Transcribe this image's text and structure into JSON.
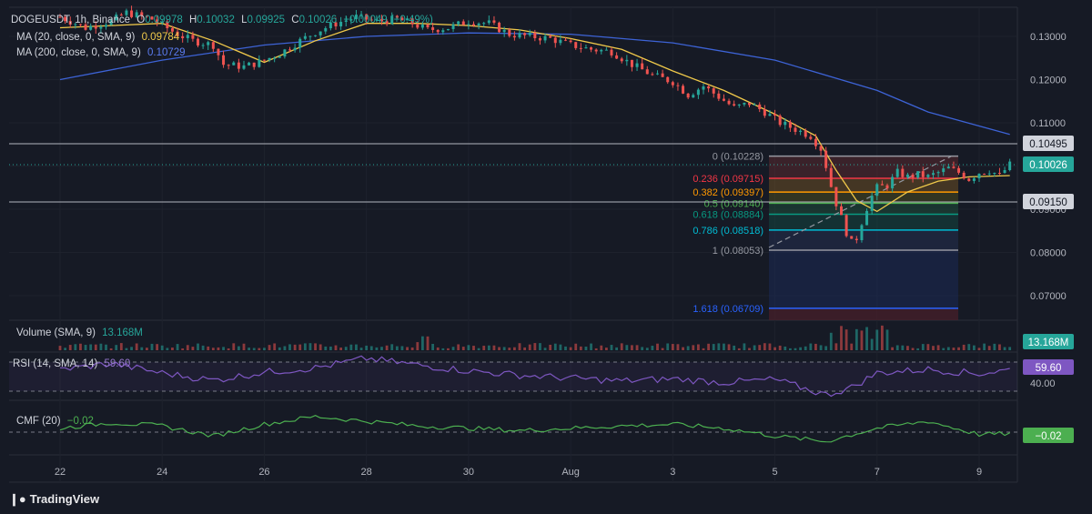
{
  "header": {
    "symbol_line": "DOGEUSDT, 1h, Binance",
    "o_label": "O",
    "o": "0.09978",
    "h_label": "H",
    "h": "0.10032",
    "l_label": "L",
    "l": "0.09925",
    "c_label": "C",
    "c": "0.10026",
    "change": "+0.00049 (+0.49%)",
    "ma20_label": "MA (20, close, 0, SMA, 9)",
    "ma20_value": "0.09784",
    "ma200_label": "MA (200, close, 0, SMA, 9)",
    "ma200_value": "0.10729"
  },
  "panes": {
    "volume_label": "Volume (SMA, 9)",
    "volume_value": "13.168M",
    "rsi_label": "RSI (14, SMA, 14)",
    "rsi_value": "59.60",
    "rsi_level": "40.00",
    "cmf_label": "CMF (20)",
    "cmf_value": "−0.02"
  },
  "price_axis_labels": [
    "0.13000",
    "0.12000",
    "0.11000",
    "0.10000",
    "0.09000",
    "0.08000",
    "0.07000"
  ],
  "price_tags": {
    "resistance": "0.10495",
    "current": "0.10026",
    "support": "0.09150",
    "volume": "13.168M",
    "rsi": "59.60",
    "cmf": "−0.02"
  },
  "colors": {
    "bg": "#161a25",
    "up": "#26a69a",
    "down": "#ef5350",
    "ma20": "#f0c94a",
    "ma200": "#3d63d6",
    "rsi": "#7e57c2",
    "cmf": "#4caf50"
  },
  "brand": "TradingView",
  "chart_data": {
    "type": "line",
    "title": "DOGEUSDT, 1h, Binance",
    "x_ticks": [
      "22",
      "24",
      "26",
      "28",
      "30",
      "Aug",
      "3",
      "5",
      "7",
      "9"
    ],
    "ylim": [
      0.064,
      0.136
    ],
    "horizontal_levels": [
      0.10495,
      0.1015,
      0.0915
    ],
    "fib_levels": [
      {
        "ratio": "0",
        "price": 0.10228,
        "label": "0 (0.10228)",
        "color": "#9598a1"
      },
      {
        "ratio": "0.236",
        "price": 0.09715,
        "label": "0.236 (0.09715)",
        "color": "#f23645"
      },
      {
        "ratio": "0.382",
        "price": 0.09397,
        "label": "0.382 (0.09397)",
        "color": "#ff9800"
      },
      {
        "ratio": "0.5",
        "price": 0.0914,
        "label": "0.5 (0.09140)",
        "color": "#4caf50"
      },
      {
        "ratio": "0.618",
        "price": 0.08884,
        "label": "0.618 (0.08884)",
        "color": "#089981"
      },
      {
        "ratio": "0.786",
        "price": 0.08518,
        "label": "0.786 (0.08518)",
        "color": "#00bcd4"
      },
      {
        "ratio": "1",
        "price": 0.08053,
        "label": "1 (0.08053)",
        "color": "#9598a1"
      },
      {
        "ratio": "1.618",
        "price": 0.06709,
        "label": "1.618 (0.06709)",
        "color": "#2962ff"
      }
    ],
    "price_series": {
      "name": "DOGEUSDT",
      "points": [
        [
          0,
          0.1345
        ],
        [
          0.5,
          0.132
        ],
        [
          1,
          0.1335
        ],
        [
          1.3,
          0.1355
        ],
        [
          1.8,
          0.134
        ],
        [
          2.3,
          0.1305
        ],
        [
          2.6,
          0.129
        ],
        [
          3.0,
          0.128
        ],
        [
          3.2,
          0.1235
        ],
        [
          3.6,
          0.123
        ],
        [
          3.9,
          0.124
        ],
        [
          4.3,
          0.126
        ],
        [
          4.7,
          0.129
        ],
        [
          5.0,
          0.131
        ],
        [
          5.4,
          0.133
        ],
        [
          5.8,
          0.1345
        ],
        [
          6.2,
          0.1335
        ],
        [
          6.6,
          0.134
        ],
        [
          6.9,
          0.133
        ],
        [
          7.2,
          0.1315
        ],
        [
          7.6,
          0.132
        ],
        [
          8.0,
          0.1335
        ],
        [
          8.4,
          0.133
        ],
        [
          8.8,
          0.1305
        ],
        [
          9.2,
          0.13
        ],
        [
          9.6,
          0.1295
        ],
        [
          10.0,
          0.128
        ],
        [
          10.4,
          0.127
        ],
        [
          10.8,
          0.1265
        ],
        [
          11.2,
          0.1235
        ],
        [
          11.6,
          0.121
        ],
        [
          12.0,
          0.1195
        ],
        [
          12.3,
          0.1165
        ],
        [
          12.6,
          0.1185
        ],
        [
          12.9,
          0.116
        ],
        [
          13.2,
          0.1135
        ],
        [
          13.5,
          0.1145
        ],
        [
          13.8,
          0.1125
        ],
        [
          14.1,
          0.11
        ],
        [
          14.4,
          0.1085
        ],
        [
          14.7,
          0.107
        ],
        [
          14.9,
          0.104
        ],
        [
          15.0,
          0.1
        ],
        [
          15.15,
          0.093
        ],
        [
          15.3,
          0.088
        ],
        [
          15.45,
          0.083
        ],
        [
          15.55,
          0.0815
        ],
        [
          15.7,
          0.087
        ],
        [
          15.85,
          0.092
        ],
        [
          16.0,
          0.095
        ],
        [
          16.2,
          0.0955
        ],
        [
          16.4,
          0.0985
        ],
        [
          16.6,
          0.0975
        ],
        [
          16.8,
          0.098
        ],
        [
          17.0,
          0.0975
        ],
        [
          17.2,
          0.0985
        ],
        [
          17.4,
          0.0995
        ],
        [
          17.6,
          0.0985
        ],
        [
          17.8,
          0.097
        ],
        [
          18.0,
          0.0985
        ],
        [
          18.2,
          0.099
        ],
        [
          18.4,
          0.0978
        ],
        [
          18.6,
          0.1003
        ]
      ]
    },
    "ma20": {
      "name": "MA (20, close, 0, SMA, 9)",
      "points": [
        [
          0,
          0.132
        ],
        [
          1,
          0.1325
        ],
        [
          2,
          0.133
        ],
        [
          3,
          0.129
        ],
        [
          4,
          0.124
        ],
        [
          5,
          0.129
        ],
        [
          6,
          0.133
        ],
        [
          7,
          0.133
        ],
        [
          8,
          0.1325
        ],
        [
          9,
          0.1315
        ],
        [
          10,
          0.1295
        ],
        [
          11,
          0.127
        ],
        [
          12,
          0.122
        ],
        [
          13,
          0.1175
        ],
        [
          14,
          0.112
        ],
        [
          14.8,
          0.107
        ],
        [
          15.2,
          0.099
        ],
        [
          15.6,
          0.092
        ],
        [
          16.0,
          0.0895
        ],
        [
          16.6,
          0.094
        ],
        [
          17.2,
          0.0965
        ],
        [
          17.8,
          0.0975
        ],
        [
          18.6,
          0.0978
        ]
      ]
    },
    "ma200": {
      "name": "MA (200, close, 0, SMA, 9)",
      "points": [
        [
          0,
          0.12
        ],
        [
          2,
          0.1245
        ],
        [
          4,
          0.128
        ],
        [
          6,
          0.13
        ],
        [
          8,
          0.1308
        ],
        [
          10,
          0.1305
        ],
        [
          12,
          0.1285
        ],
        [
          14,
          0.1245
        ],
        [
          16,
          0.1175
        ],
        [
          17,
          0.1125
        ],
        [
          18.6,
          0.1073
        ]
      ]
    },
    "volume": {
      "name": "Volume (SMA, 9)",
      "last": "13.168M"
    },
    "rsi": {
      "name": "RSI (14, SMA, 14)",
      "ylim": [
        20,
        80
      ],
      "levels": [
        70,
        30
      ],
      "last": 59.6,
      "points": [
        [
          0,
          60
        ],
        [
          1,
          68
        ],
        [
          2,
          55
        ],
        [
          3,
          45
        ],
        [
          4,
          56
        ],
        [
          5,
          62
        ],
        [
          6,
          75
        ],
        [
          7,
          66
        ],
        [
          8,
          58
        ],
        [
          9,
          52
        ],
        [
          10,
          48
        ],
        [
          11,
          44
        ],
        [
          12,
          47
        ],
        [
          13,
          42
        ],
        [
          14,
          46
        ],
        [
          15,
          25
        ],
        [
          15.5,
          35
        ],
        [
          16,
          55
        ],
        [
          17,
          60
        ],
        [
          18,
          54
        ],
        [
          18.6,
          59.6
        ]
      ]
    },
    "cmf": {
      "name": "CMF (20)",
      "ylim": [
        -0.35,
        0.35
      ],
      "levels": [
        0
      ],
      "last": -0.02,
      "points": [
        [
          0,
          0.05
        ],
        [
          1,
          0.12
        ],
        [
          2,
          0.08
        ],
        [
          3,
          -0.05
        ],
        [
          4,
          0.1
        ],
        [
          5,
          0.2
        ],
        [
          6,
          0.14
        ],
        [
          7,
          0.08
        ],
        [
          8,
          0.05
        ],
        [
          9,
          0.02
        ],
        [
          10,
          0.05
        ],
        [
          11,
          0.08
        ],
        [
          12,
          0.1
        ],
        [
          13,
          0.05
        ],
        [
          14,
          -0.05
        ],
        [
          15,
          -0.12
        ],
        [
          16,
          0.05
        ],
        [
          17,
          0.14
        ],
        [
          18,
          -0.03
        ],
        [
          18.6,
          -0.02
        ]
      ]
    }
  }
}
